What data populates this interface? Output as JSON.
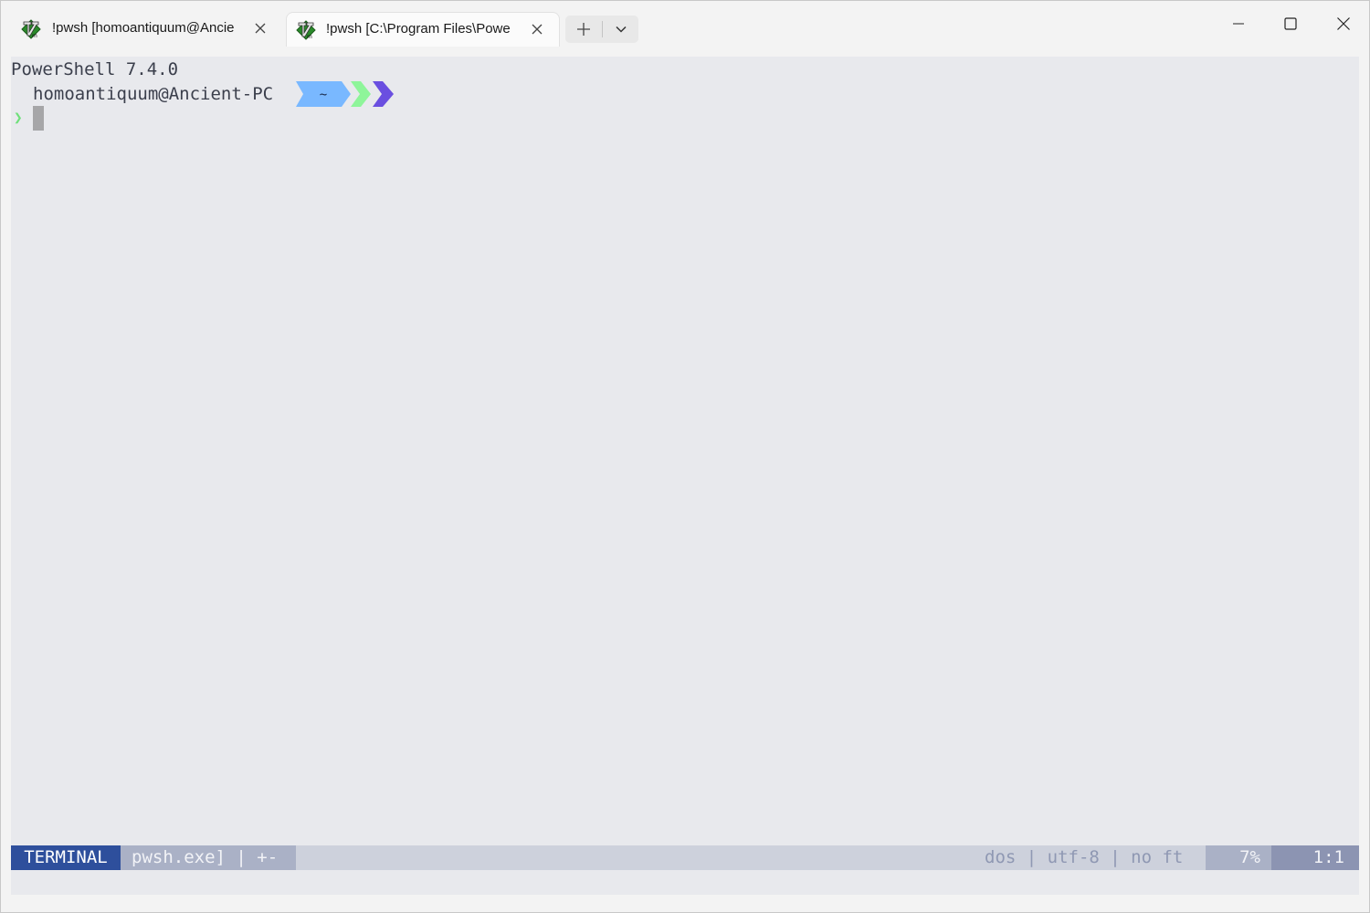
{
  "tabs": [
    {
      "title": "!pwsh [homoantiquum@Ancie",
      "icon": "vim-icon",
      "active": false
    },
    {
      "title": "!pwsh [C:\\Program Files\\Powe",
      "icon": "vim-icon",
      "active": true
    }
  ],
  "terminal": {
    "version_line": "PowerShell 7.4.0",
    "user_host": "homoantiquum@Ancient-PC",
    "path": "~",
    "prompt_symbol": "❯",
    "colors": {
      "path_segment": "#79b8ff",
      "chevron_green": "#8ef59a",
      "chevron_purple": "#6a4fe0",
      "prompt_green": "#6fe07a"
    }
  },
  "statusline": {
    "mode": "TERMINAL",
    "file": "pwsh.exe] | +-",
    "info": "dos | utf-8 | no ft",
    "percent": "7%",
    "position": "1:1",
    "colors": {
      "mode_bg": "#2e4f9c"
    }
  }
}
